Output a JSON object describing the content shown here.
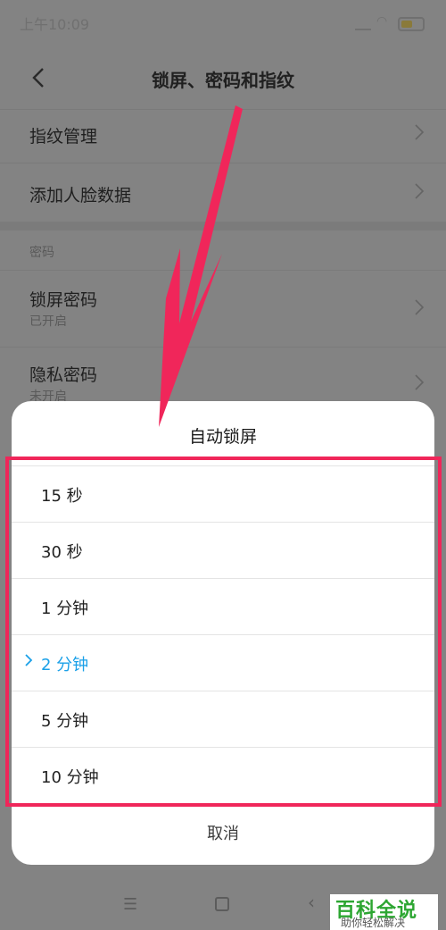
{
  "status_bar": {
    "time": "上午10:09"
  },
  "header": {
    "title": "锁屏、密码和指纹",
    "back_icon": "chevron-left-icon"
  },
  "settings": {
    "fingerprint_label": "指纹管理",
    "face_label": "添加人脸数据",
    "password_section": "密码",
    "lock_password_label": "锁屏密码",
    "lock_password_status": "已开启",
    "privacy_password_label": "隐私密码",
    "privacy_password_status": "未开启"
  },
  "dialog": {
    "title": "自动锁屏",
    "options": [
      {
        "label": "15 秒",
        "selected": false
      },
      {
        "label": "30 秒",
        "selected": false
      },
      {
        "label": "1 分钟",
        "selected": false
      },
      {
        "label": "2 分钟",
        "selected": true
      },
      {
        "label": "5 分钟",
        "selected": false
      },
      {
        "label": "10 分钟",
        "selected": false
      }
    ],
    "cancel_label": "取消"
  },
  "colors": {
    "accent": "#1aa0e8",
    "annotation": "#f0265a",
    "watermark_green": "#2da632"
  },
  "watermark": {
    "main": "百科全说",
    "sub": "助你轻松解决"
  }
}
